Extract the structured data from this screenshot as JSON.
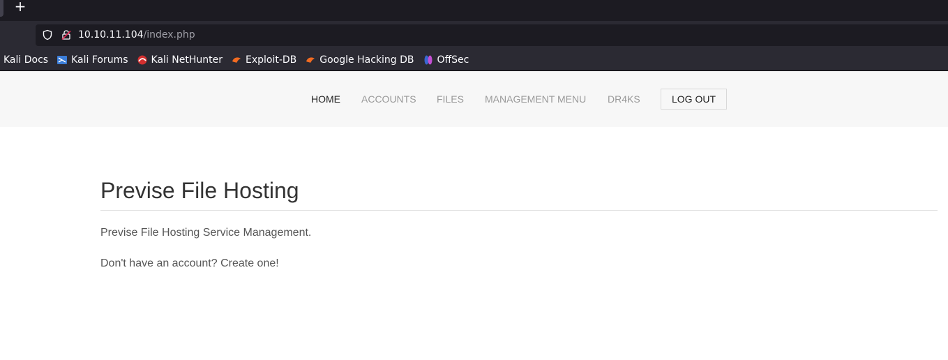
{
  "browser": {
    "new_tab_symbol": "+",
    "url_host": "10.10.11.104",
    "url_path": "/index.php",
    "bookmarks": [
      {
        "label": "Kali Docs",
        "icon": "none"
      },
      {
        "label": "Kali Forums",
        "icon": "kali-forums-icon"
      },
      {
        "label": "Kali NetHunter",
        "icon": "kali-nethunter-icon"
      },
      {
        "label": "Exploit-DB",
        "icon": "exploit-db-icon"
      },
      {
        "label": "Google Hacking DB",
        "icon": "ghdb-icon"
      },
      {
        "label": "OffSec",
        "icon": "offsec-icon"
      }
    ]
  },
  "nav": {
    "home": "HOME",
    "accounts": "ACCOUNTS",
    "files": "FILES",
    "management_menu": "MANAGEMENT MENU",
    "user": "DR4KS",
    "logout": "LOG OUT"
  },
  "main": {
    "title": "Previse File Hosting",
    "description": "Previse File Hosting Service Management.",
    "signup_prompt": "Don't have an account?",
    "signup_link": "Create one!"
  },
  "colors": {
    "chrome_dark": "#1c1b22",
    "chrome": "#2b2a33",
    "nav_bg": "#f7f7f7",
    "nav_inactive": "#999999",
    "nav_active": "#222222",
    "text": "#555555"
  }
}
